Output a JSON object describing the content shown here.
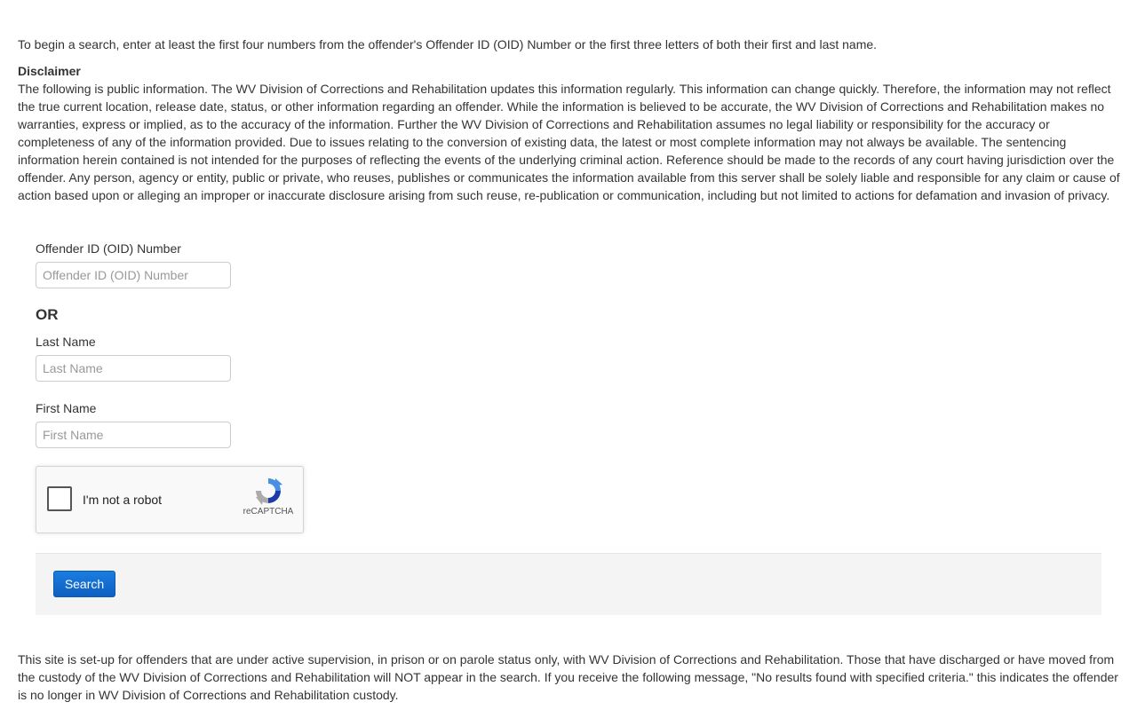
{
  "intro": "To begin a search, enter at least the first four numbers from the offender's Offender ID (OID) Number or the first three letters of both their first and last name.",
  "disclaimer": {
    "title": "Disclaimer",
    "body": "The following is public information. The WV Division of Corrections and Rehabilitation updates this information regularly. This information can change quickly. Therefore, the information may not reflect the true current location, release date, status, or other information regarding an offender. While the information is believed to be accurate, the WV Division of Corrections and Rehabilitation makes no warranties, express or implied, as to the accuracy of the information. Further the WV Division of Corrections and Rehabilitation assumes no legal liability or responsibility for the accuracy or completeness of any of the information provided. Due to issues relating to the conversion of existing data, the latest or most complete information may not always be available. The sentencing information herein contained is not intended for the purposes of reflecting the events of the underlying criminal action. Reference should be made to the records of any court having jurisdiction over the offender. Any person, agency or entity, public or private, who reuses, publishes or communicates the information available from this server shall be solely liable and responsible for any claim or cause of action based upon or alleging an improper or inaccurate disclosure arising from such reuse, re-publication or communication, including but not limited to actions for defamation and invasion of privacy."
  },
  "form": {
    "oid": {
      "label": "Offender ID (OID) Number",
      "placeholder": "Offender ID (OID) Number",
      "value": ""
    },
    "or_label": "OR",
    "last_name": {
      "label": "Last Name",
      "placeholder": "Last Name",
      "value": ""
    },
    "first_name": {
      "label": "First Name",
      "placeholder": "First Name",
      "value": ""
    },
    "captcha": {
      "label": "I'm not a robot",
      "brand": "reCAPTCHA",
      "checked": false,
      "icon": "recaptcha-logo-icon"
    },
    "search_button": "Search"
  },
  "footer_note": "This site is set-up for offenders that are under active supervision, in prison or on parole status only, with WV Division of Corrections and Rehabilitation. Those that have discharged or have moved from the custody of the WV Division of Corrections and Rehabilitation will NOT appear in the search. If you receive the following message, \"No results found with specified criteria.\" this indicates the offender is no longer in WV Division of Corrections and Rehabilitation custody.",
  "colors": {
    "button": "#0e6dd0",
    "action_bar": "#f4f4f4",
    "text": "#333333"
  }
}
